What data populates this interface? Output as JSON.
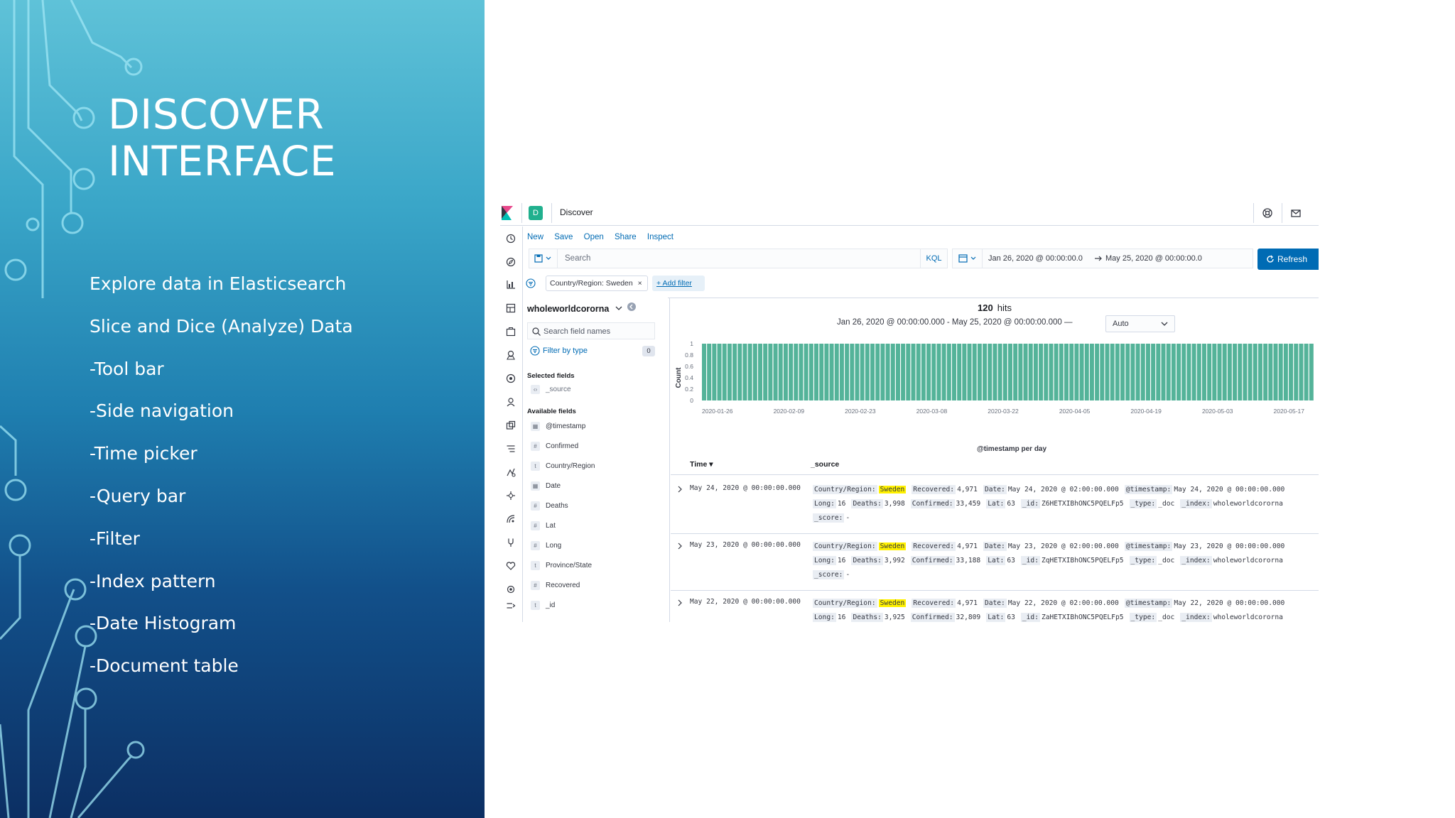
{
  "slide": {
    "title_lines": [
      "DISCOVER",
      "INTERFACE"
    ],
    "bullets": [
      "Explore data in Elasticsearch",
      "Slice and Dice (Analyze) Data",
      "-Tool bar",
      "-Side navigation",
      "-Time picker",
      "-Query bar",
      "-Filter",
      "-Index pattern",
      "-Date Histogram",
      "-Document table"
    ],
    "colors": {
      "panel_top": "#5fc2d8",
      "panel_bottom": "#0c2f63"
    }
  },
  "kibana": {
    "space_badge": "D",
    "app_title": "Discover",
    "menu": {
      "new": "New",
      "save": "Save",
      "open": "Open",
      "share": "Share",
      "inspect": "Inspect"
    },
    "query": {
      "placeholder": "Search",
      "language": "KQL"
    },
    "time": {
      "start": "Jan 26, 2020 @ 00:00:00.0",
      "end": "May 25, 2020 @ 00:00:00.0"
    },
    "refresh_label": "Refresh",
    "filter": {
      "pill": "Country/Region: Sweden",
      "add": "+ Add filter"
    },
    "sidebar": {
      "index_pattern": "wholeworldcororna",
      "field_search_placeholder": "Search field names",
      "filter_by_type": "Filter by type",
      "filter_count": "0",
      "selected_header": "Selected fields",
      "selected_fields": [
        {
          "type": "s",
          "name": "_source"
        }
      ],
      "available_header": "Available fields",
      "available_fields": [
        {
          "type": "d",
          "name": "@timestamp"
        },
        {
          "type": "#",
          "name": "Confirmed"
        },
        {
          "type": "t",
          "name": "Country/Region"
        },
        {
          "type": "d",
          "name": "Date"
        },
        {
          "type": "#",
          "name": "Deaths"
        },
        {
          "type": "#",
          "name": "Lat"
        },
        {
          "type": "#",
          "name": "Long"
        },
        {
          "type": "t",
          "name": "Province/State"
        },
        {
          "type": "#",
          "name": "Recovered"
        },
        {
          "type": "t",
          "name": "_id"
        }
      ]
    },
    "main": {
      "hits_count": "120",
      "hits_label": "hits",
      "range_text": "Jan 26, 2020 @ 00:00:00.000 - May 25, 2020 @ 00:00:00.000 —",
      "interval": "Auto"
    },
    "table": {
      "col_time": "Time",
      "col_source": "_source",
      "rows": [
        {
          "time": "May 24, 2020 @ 00:00:00.000",
          "lines": [
            [
              [
                "Country/Region:",
                "Sweden",
                true
              ],
              [
                "Recovered:",
                "4,971"
              ],
              [
                "Date:",
                "May 24, 2020 @ 02:00:00.000"
              ],
              [
                "@timestamp:",
                "May 24, 2020 @ 00:00:00.000"
              ]
            ],
            [
              [
                "Long:",
                "16"
              ],
              [
                "Deaths:",
                "3,998"
              ],
              [
                "Confirmed:",
                "33,459"
              ],
              [
                "Lat:",
                "63"
              ],
              [
                "_id:",
                "Z6HETXIBhONC5PQELFp5"
              ],
              [
                "_type:",
                "_doc"
              ],
              [
                "_index:",
                "wholeworldcororna"
              ]
            ],
            [
              [
                "_score:",
                "-"
              ]
            ]
          ]
        },
        {
          "time": "May 23, 2020 @ 00:00:00.000",
          "lines": [
            [
              [
                "Country/Region:",
                "Sweden",
                true
              ],
              [
                "Recovered:",
                "4,971"
              ],
              [
                "Date:",
                "May 23, 2020 @ 02:00:00.000"
              ],
              [
                "@timestamp:",
                "May 23, 2020 @ 00:00:00.000"
              ]
            ],
            [
              [
                "Long:",
                "16"
              ],
              [
                "Deaths:",
                "3,992"
              ],
              [
                "Confirmed:",
                "33,188"
              ],
              [
                "Lat:",
                "63"
              ],
              [
                "_id:",
                "ZqHETXIBhONC5PQELFp5"
              ],
              [
                "_type:",
                "_doc"
              ],
              [
                "_index:",
                "wholeworldcororna"
              ]
            ],
            [
              [
                "_score:",
                "-"
              ]
            ]
          ]
        },
        {
          "time": "May 22, 2020 @ 00:00:00.000",
          "lines": [
            [
              [
                "Country/Region:",
                "Sweden",
                true
              ],
              [
                "Recovered:",
                "4,971"
              ],
              [
                "Date:",
                "May 22, 2020 @ 02:00:00.000"
              ],
              [
                "@timestamp:",
                "May 22, 2020 @ 00:00:00.000"
              ]
            ],
            [
              [
                "Long:",
                "16"
              ],
              [
                "Deaths:",
                "3,925"
              ],
              [
                "Confirmed:",
                "32,809"
              ],
              [
                "Lat:",
                "63"
              ],
              [
                "_id:",
                "ZaHETXIBhONC5PQELFp5"
              ],
              [
                "_type:",
                "_doc"
              ],
              [
                "_index:",
                "wholeworldcororna"
              ]
            ]
          ]
        }
      ]
    }
  },
  "chart_data": {
    "type": "bar",
    "x_start": "2020-01-26",
    "x_end": "2020-05-24",
    "interval": "day",
    "bar_value": 1,
    "ylim": [
      0,
      1
    ],
    "y_ticks": [
      "0",
      "0.2",
      "0.4",
      "0.6",
      "0.8",
      "1"
    ],
    "x_ticks": [
      "2020-01-26",
      "2020-02-09",
      "2020-02-23",
      "2020-03-08",
      "2020-03-22",
      "2020-04-05",
      "2020-04-19",
      "2020-05-03",
      "2020-05-17"
    ],
    "ylabel": "Count",
    "xlabel": "@timestamp per day",
    "bar_color": "#54b399",
    "grid": false
  }
}
